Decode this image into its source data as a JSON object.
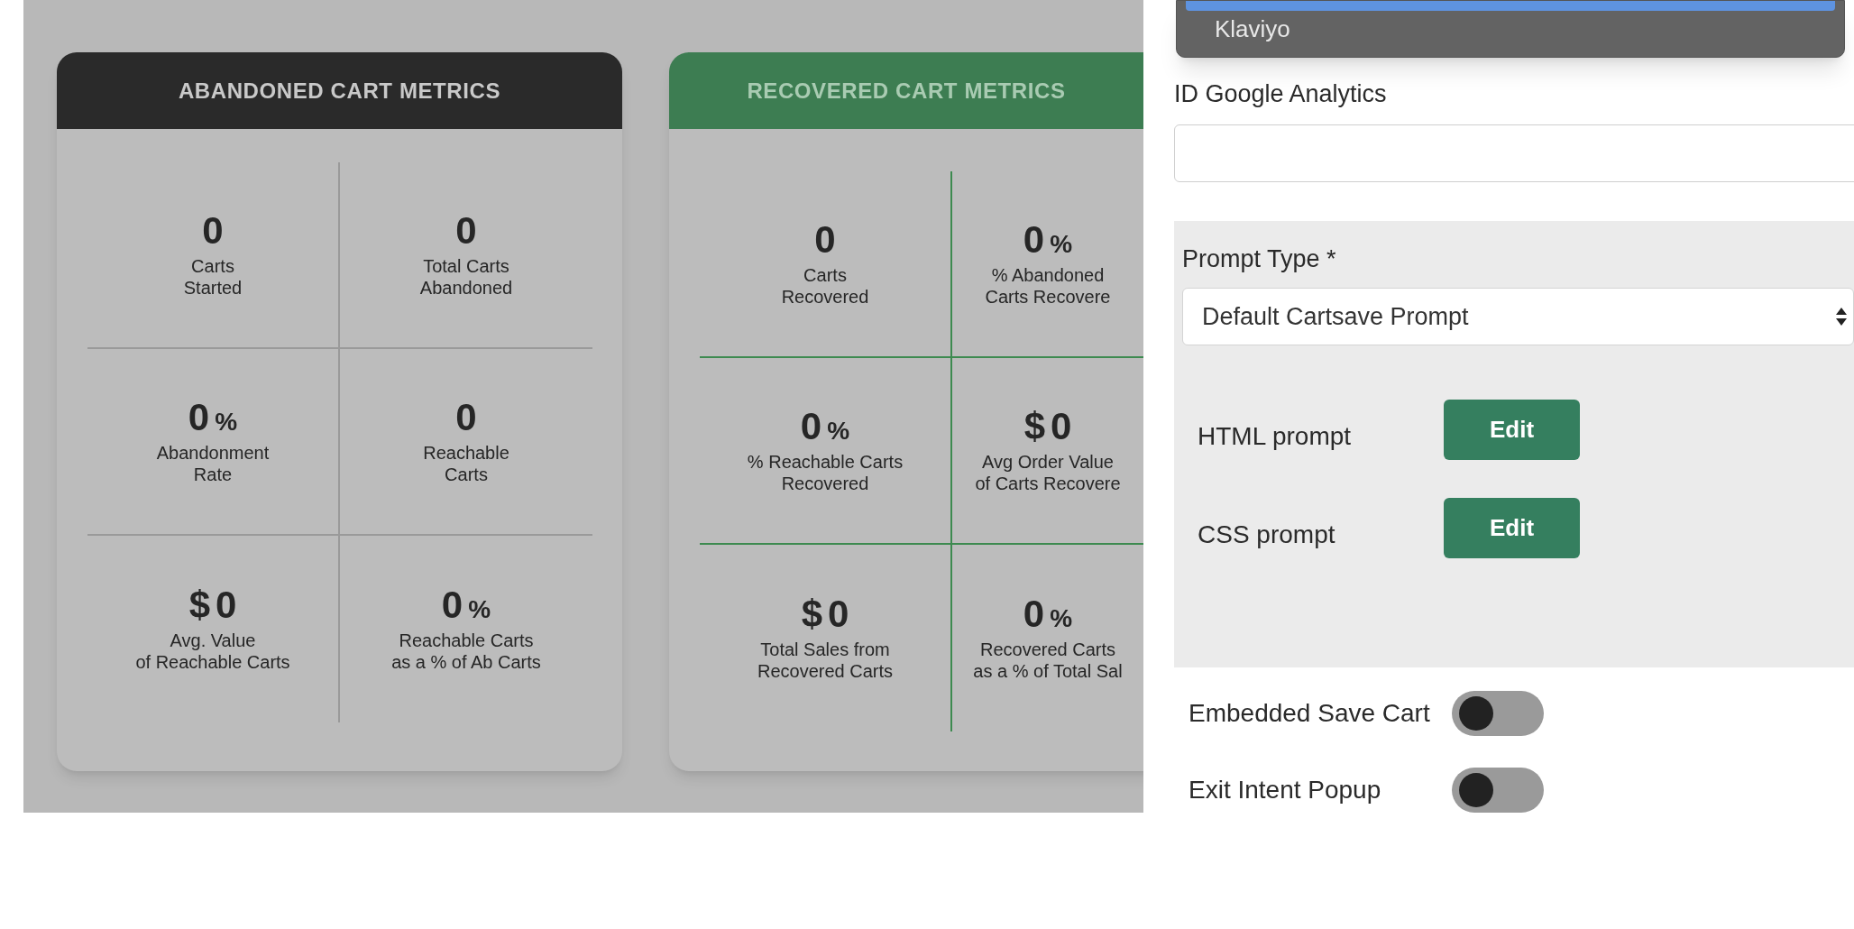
{
  "cards": [
    {
      "title": "ABANDONED CART METRICS",
      "color": "#2a2a2a",
      "metrics": [
        {
          "value": "0",
          "label": [
            "Carts",
            "Started"
          ]
        },
        {
          "value": "0",
          "label": [
            "Total Carts",
            "Abandoned"
          ]
        },
        {
          "value": "0",
          "unit": "%",
          "label": [
            "Abandonment",
            "Rate"
          ]
        },
        {
          "value": "0",
          "label": [
            "Reachable",
            "Carts"
          ]
        },
        {
          "currency": "$",
          "value": "0",
          "label": [
            "Avg. Value",
            "of Reachable Carts"
          ]
        },
        {
          "value": "0",
          "unit": "%",
          "label": [
            "Reachable Carts",
            "as a % of Ab Carts"
          ]
        }
      ]
    },
    {
      "title": "RECOVERED CART METRICS",
      "color": "#3d7d52",
      "metrics": [
        {
          "value": "0",
          "label": [
            "Carts",
            "Recovered"
          ]
        },
        {
          "value": "0",
          "unit": "%",
          "label": [
            "% Abandoned",
            "Carts Recovere"
          ]
        },
        {
          "value": "0",
          "unit": "%",
          "label": [
            "% Reachable Carts",
            "Recovered"
          ]
        },
        {
          "currency": "$",
          "value": "0",
          "label": [
            "Avg Order Value",
            "of Carts Recovere"
          ]
        },
        {
          "currency": "$",
          "value": "0",
          "label": [
            "Total Sales from",
            "Recovered Carts"
          ]
        },
        {
          "value": "0",
          "unit": "%",
          "label": [
            "Recovered Carts",
            "as a % of Total Sal"
          ]
        }
      ]
    }
  ],
  "settings_panel": {
    "dropdown_options": [
      {
        "label": "Klaviyo",
        "selected": false
      }
    ],
    "ga_field": {
      "label": "ID Google Analytics"
    },
    "prompt_type": {
      "label": "Prompt Type *",
      "value": "Default Cartsave Prompt"
    },
    "prompt_rows": [
      {
        "label": "HTML prompt",
        "button": "Edit"
      },
      {
        "label": "CSS prompt",
        "button": "Edit"
      }
    ],
    "toggles": [
      {
        "label": "Embedded Save Cart",
        "on": false
      },
      {
        "label": "Exit Intent Popup",
        "on": false
      }
    ]
  }
}
